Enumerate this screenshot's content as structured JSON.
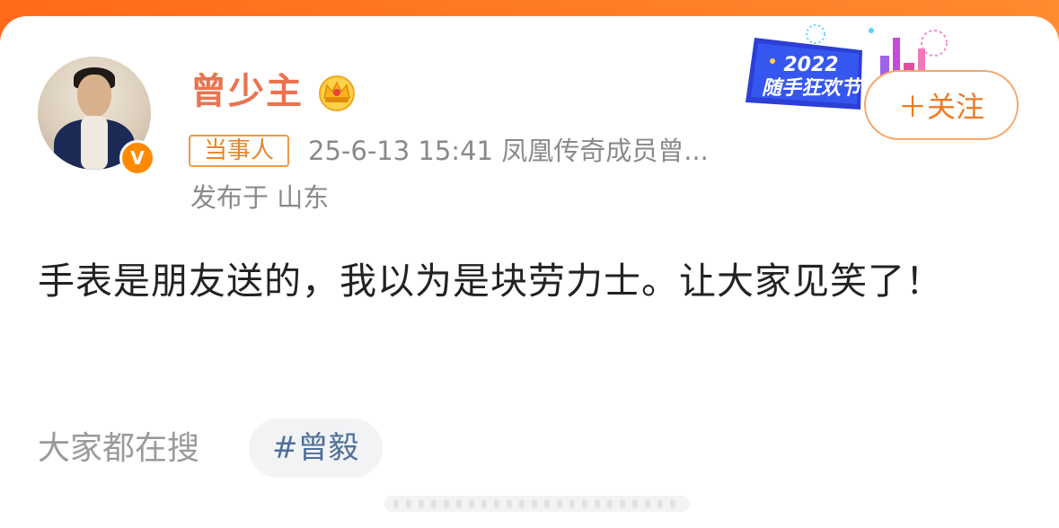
{
  "post": {
    "username": "曾少主",
    "tag": "当事人",
    "meta": "25-6-13 15:41  凤凰传奇成员曾...",
    "location": "发布于 山东",
    "text": "手表是朋友送的，我以为是块劳力士。让大家见笑了！"
  },
  "header": {
    "follow_label": "＋关注",
    "banner_line1": "2022",
    "banner_line2": "随手狂欢节"
  },
  "trending": {
    "label": "大家都在搜",
    "hashtag": "#曾毅"
  },
  "icons": {
    "verified": "verified-v-icon",
    "crown": "crown-icon"
  },
  "colors": {
    "accent": "#ff8a00",
    "username": "#eb7350",
    "link": "#4f6f99"
  }
}
